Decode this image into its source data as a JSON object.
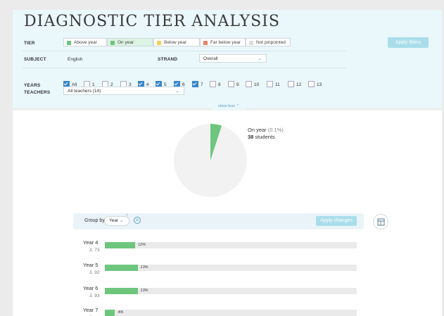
{
  "title": "DIAGNOSTIC TIER ANALYSIS",
  "filters": {
    "tier_label": "TIER",
    "tiers": [
      {
        "label": "Above year",
        "color": "#6dc67d",
        "selected": false
      },
      {
        "label": "On year",
        "color": "#6dc67d",
        "selected": true
      },
      {
        "label": "Below year",
        "color": "#f2d25a",
        "selected": false
      },
      {
        "label": "Far below year",
        "color": "#e8846a",
        "selected": false
      },
      {
        "label": "Not pinpointed",
        "color": "#dddddd",
        "selected": false
      }
    ],
    "apply_label": "Apply filters",
    "subject_label": "SUBJECT",
    "subject_value": "English",
    "strand_label": "STRAND",
    "strand_value": "Overall",
    "years_label": "YEARS",
    "years": [
      {
        "label": "All",
        "checked": true
      },
      {
        "label": "1",
        "checked": false
      },
      {
        "label": "2",
        "checked": false
      },
      {
        "label": "3",
        "checked": false
      },
      {
        "label": "4",
        "checked": true
      },
      {
        "label": "5",
        "checked": true
      },
      {
        "label": "6",
        "checked": true
      },
      {
        "label": "7",
        "checked": true
      },
      {
        "label": "8",
        "checked": false
      },
      {
        "label": "9",
        "checked": false
      },
      {
        "label": "10",
        "checked": false
      },
      {
        "label": "11",
        "checked": false
      },
      {
        "label": "12",
        "checked": false
      },
      {
        "label": "13",
        "checked": false
      }
    ],
    "teachers_label": "TEACHERS",
    "teachers_value": "All teachers (14)",
    "show_less": "show less ⌃"
  },
  "pie": {
    "label": "On year",
    "pct": "(0.1%)",
    "count": "38",
    "count_suffix": " students",
    "slice_fraction": 0.05,
    "slice_color": "#6dc67d",
    "rest_color": "#f2f2f2"
  },
  "group": {
    "label": "Group by",
    "value": "Year",
    "close": "×",
    "add": "+",
    "apply_label": "Apply changes"
  },
  "bars": [
    {
      "name": "Year 4",
      "count": "73",
      "pct_label": "12%",
      "pct": 12
    },
    {
      "name": "Year 5",
      "count": "92",
      "pct_label": "13%",
      "pct": 13
    },
    {
      "name": "Year 6",
      "count": "93",
      "pct_label": "13%",
      "pct": 13
    },
    {
      "name": "Year 7",
      "count": "",
      "pct_label": "4%",
      "pct": 4
    }
  ]
}
